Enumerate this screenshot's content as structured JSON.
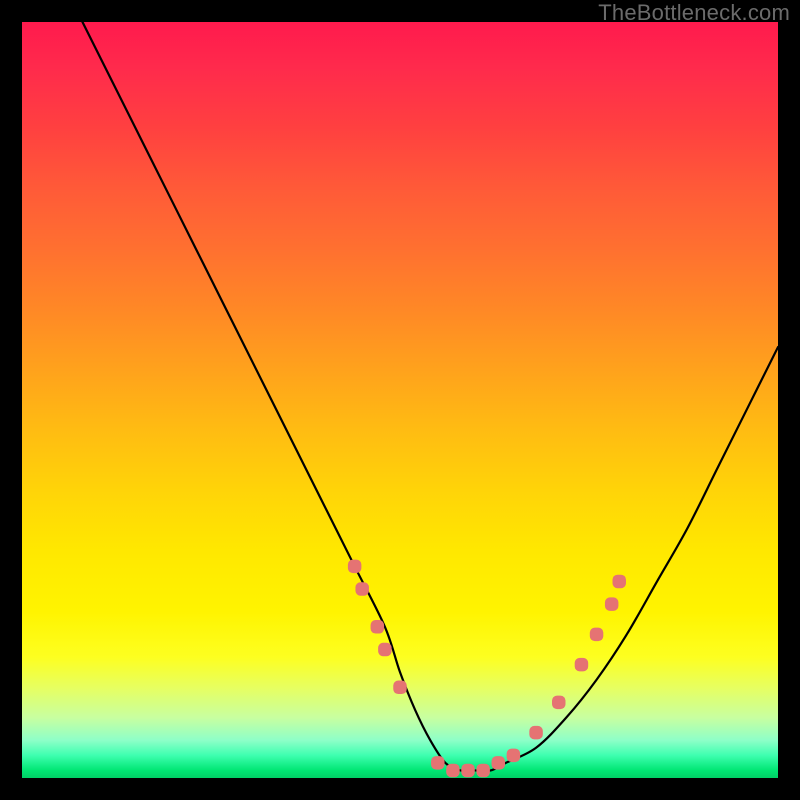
{
  "watermark": "TheBottleneck.com",
  "chart_data": {
    "type": "line",
    "title": "",
    "xlabel": "",
    "ylabel": "",
    "xlim": [
      0,
      100
    ],
    "ylim": [
      0,
      100
    ],
    "grid": false,
    "legend": false,
    "series": [
      {
        "name": "bottleneck-curve",
        "color": "#000000",
        "x": [
          8,
          12,
          16,
          20,
          24,
          28,
          32,
          36,
          40,
          44,
          48,
          50,
          52,
          54,
          56,
          58,
          60,
          62,
          64,
          68,
          72,
          76,
          80,
          84,
          88,
          92,
          96,
          100
        ],
        "y": [
          100,
          92,
          84,
          76,
          68,
          60,
          52,
          44,
          36,
          28,
          20,
          14,
          9,
          5,
          2,
          1,
          1,
          1,
          2,
          4,
          8,
          13,
          19,
          26,
          33,
          41,
          49,
          57
        ]
      }
    ],
    "markers": {
      "name": "highlight-dots",
      "color": "#e57373",
      "size": 10,
      "points": [
        {
          "x": 44,
          "y": 28
        },
        {
          "x": 45,
          "y": 25
        },
        {
          "x": 47,
          "y": 20
        },
        {
          "x": 48,
          "y": 17
        },
        {
          "x": 50,
          "y": 12
        },
        {
          "x": 55,
          "y": 2
        },
        {
          "x": 57,
          "y": 1
        },
        {
          "x": 59,
          "y": 1
        },
        {
          "x": 61,
          "y": 1
        },
        {
          "x": 63,
          "y": 2
        },
        {
          "x": 65,
          "y": 3
        },
        {
          "x": 68,
          "y": 6
        },
        {
          "x": 71,
          "y": 10
        },
        {
          "x": 74,
          "y": 15
        },
        {
          "x": 76,
          "y": 19
        },
        {
          "x": 78,
          "y": 23
        },
        {
          "x": 79,
          "y": 26
        }
      ]
    }
  }
}
